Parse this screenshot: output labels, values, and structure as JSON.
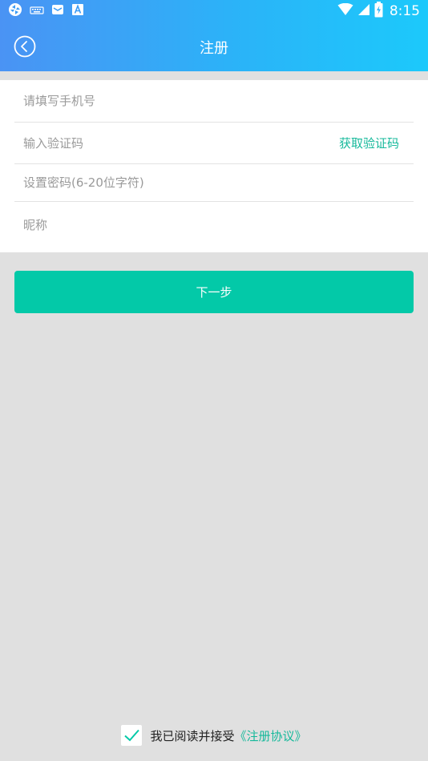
{
  "status_bar": {
    "time": "8:15",
    "icons": [
      "vpn-icon",
      "keyboard-icon",
      "mail-icon",
      "a-letter-icon",
      "wifi-icon",
      "signal-icon",
      "battery-icon"
    ]
  },
  "header": {
    "title": "注册",
    "back_icon": "back-arrow-icon"
  },
  "form": {
    "phone_placeholder": "请填写手机号",
    "code_placeholder": "输入验证码",
    "get_code_label": "获取验证码",
    "password_placeholder": "设置密码(6-20位字符)",
    "nickname_placeholder": "昵称"
  },
  "next_button": {
    "label": "下一步"
  },
  "agreement": {
    "checked": true,
    "text": "我已阅读并接受",
    "link": "《注册协议》"
  },
  "colors": {
    "header_gradient_start": "#4a93f4",
    "header_gradient_end": "#1cc9fb",
    "accent": "#03c9a8",
    "link": "#16b99b",
    "background": "#e0e0e0"
  }
}
